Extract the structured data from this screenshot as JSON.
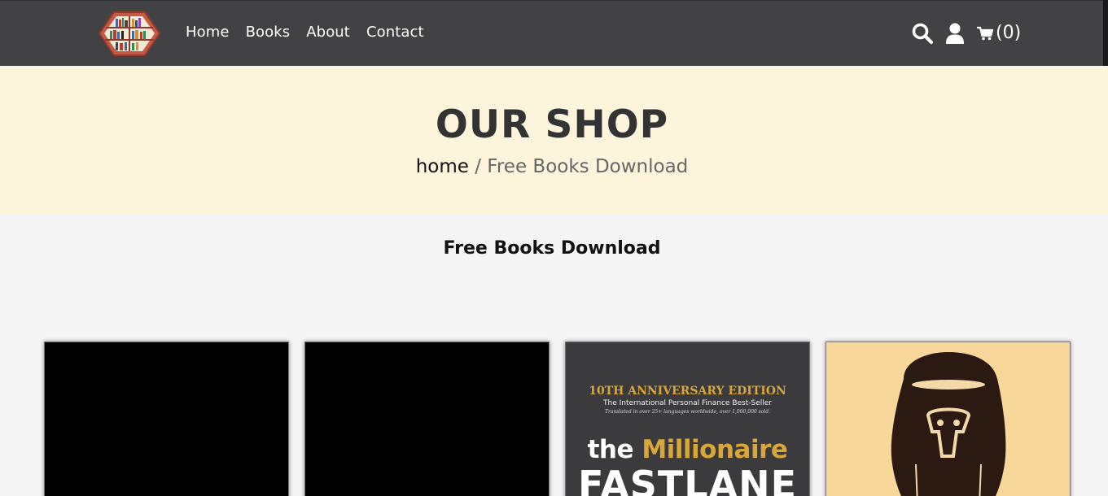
{
  "nav": {
    "links": [
      "Home",
      "Books",
      "About",
      "Contact"
    ],
    "cart_count": "(0)"
  },
  "hero": {
    "title": "OUR SHOP",
    "breadcrumb_home": "home",
    "breadcrumb_sep": " / ",
    "breadcrumb_current": "Free Books Download"
  },
  "section": {
    "title": "Free Books Download"
  },
  "books": [
    {
      "cover": "blank"
    },
    {
      "cover": "blank"
    },
    {
      "cover": "fastlane",
      "edition": "10TH ANNIVERSARY EDITION",
      "subtitle": "The International Personal Finance Best-Seller",
      "tagline": "Translated in over 25+ languages worldwide, over 1,000,000 sold.",
      "title_the": "the",
      "title_millionaire": "Millionaire",
      "title_fastlane": "FASTLANE"
    },
    {
      "cover": "mask-illustration"
    }
  ],
  "icons": {
    "logo": "bookshelf-logo-icon",
    "search": "search-icon",
    "user": "user-icon",
    "cart": "cart-icon"
  },
  "colors": {
    "navbar": "#424245",
    "hero_bg": "#fdf4dc",
    "page_bg": "#f5f5f5",
    "gold": "#d9a63a"
  }
}
